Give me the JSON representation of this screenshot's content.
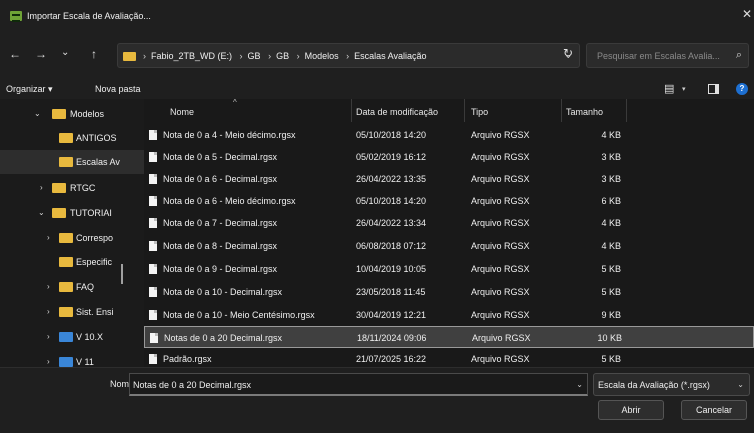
{
  "window": {
    "title": "Importar Escala de Avaliação...",
    "close_glyph": "✕"
  },
  "nav": {
    "back_glyph": "←",
    "forward_glyph": "→",
    "recent_glyph": "⌄",
    "up_glyph": "↑",
    "breadcrumbs": [
      "Fabio_2TB_WD (E:)",
      "GB",
      "GB",
      "Modelos",
      "Escalas Avaliação"
    ],
    "separator": "›",
    "dropdown_glyph": "⌄",
    "refresh_glyph": "↻",
    "search_placeholder": "Pesquisar em Escalas Avalia...",
    "search_glyph": "⌕"
  },
  "toolbar": {
    "organize_label": "Organizar ▾",
    "new_folder_label": "Nova pasta",
    "view_glyph": "▤",
    "view_dropdown_glyph": "▾",
    "help_glyph": "?"
  },
  "sidebar": {
    "items": [
      {
        "label": "Modelos",
        "chevron": "⌄",
        "level": 1
      },
      {
        "label": "ANTIGOS",
        "chevron": "",
        "level": 2
      },
      {
        "label": "Escalas Av",
        "chevron": "",
        "level": 2,
        "selected": true
      },
      {
        "label": "RTGC",
        "chevron": "›",
        "level": 1
      },
      {
        "label": "TUTORIAI",
        "chevron": "⌄",
        "level": 1
      },
      {
        "label": "Correspo",
        "chevron": "›",
        "level": 2
      },
      {
        "label": "Especific",
        "chevron": "",
        "level": 2
      },
      {
        "label": "FAQ",
        "chevron": "›",
        "level": 2
      },
      {
        "label": "Sist. Ensi",
        "chevron": "›",
        "level": 2
      },
      {
        "label": "V 10.X",
        "chevron": "›",
        "level": 2,
        "blue": true
      },
      {
        "label": "V 11",
        "chevron": "›",
        "level": 2,
        "blue": true
      }
    ]
  },
  "filelist": {
    "headers": {
      "name": "Nome",
      "modified": "Data de modificação",
      "type": "Tipo",
      "size": "Tamanho",
      "sort_glyph": "^"
    },
    "rows": [
      {
        "name": "Nota de 0 a 4 - Meio décimo.rgsx",
        "modified": "05/10/2018 14:20",
        "type": "Arquivo RGSX",
        "size": "4 KB"
      },
      {
        "name": "Nota de 0 a 5 - Decimal.rgsx",
        "modified": "05/02/2019 16:12",
        "type": "Arquivo RGSX",
        "size": "3 KB"
      },
      {
        "name": "Nota de 0 a 6 - Decimal.rgsx",
        "modified": "26/04/2022 13:35",
        "type": "Arquivo RGSX",
        "size": "3 KB"
      },
      {
        "name": "Nota de 0 a 6 - Meio décimo.rgsx",
        "modified": "05/10/2018 14:20",
        "type": "Arquivo RGSX",
        "size": "6 KB"
      },
      {
        "name": "Nota de 0 a 7 - Decimal.rgsx",
        "modified": "26/04/2022 13:34",
        "type": "Arquivo RGSX",
        "size": "4 KB"
      },
      {
        "name": "Nota de 0 a 8 - Decimal.rgsx",
        "modified": "06/08/2018 07:12",
        "type": "Arquivo RGSX",
        "size": "4 KB"
      },
      {
        "name": "Nota de 0 a 9 - Decimal.rgsx",
        "modified": "10/04/2019 10:05",
        "type": "Arquivo RGSX",
        "size": "5 KB"
      },
      {
        "name": "Nota de 0 a 10 - Decimal.rgsx",
        "modified": "23/05/2018 11:45",
        "type": "Arquivo RGSX",
        "size": "5 KB"
      },
      {
        "name": "Nota de 0 a 10 - Meio Centésimo.rgsx",
        "modified": "30/04/2019 12:21",
        "type": "Arquivo RGSX",
        "size": "9 KB"
      },
      {
        "name": "Notas de 0 a 20 Decimal.rgsx",
        "modified": "18/11/2024 09:06",
        "type": "Arquivo RGSX",
        "size": "10 KB",
        "selected": true
      },
      {
        "name": "Padrão.rgsx",
        "modified": "21/07/2025 16:22",
        "type": "Arquivo RGSX",
        "size": "5 KB"
      }
    ]
  },
  "footer": {
    "name_label": "Nome:",
    "name_value": "Notas de 0 a 20 Decimal.rgsx",
    "name_dropdown_glyph": "⌄",
    "filter_value": "Escala da Avaliação (*.rgsx)",
    "filter_dropdown_glyph": "⌄",
    "open_label": "Abrir",
    "cancel_label": "Cancelar"
  },
  "colors": {
    "background": "#1e1e1e",
    "folder": "#e8b93e",
    "accent": "#1d6fd1",
    "selected_row": "#404040"
  }
}
